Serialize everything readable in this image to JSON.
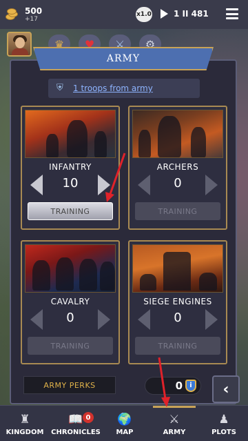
{
  "topbar": {
    "gold_amount": "500",
    "gold_delta": "+17",
    "speed": "x1.0",
    "date": "1 II 481"
  },
  "tabs": [
    {
      "icon": "crown-icon",
      "glyph": "♛"
    },
    {
      "icon": "heart-icon",
      "glyph": "♥"
    },
    {
      "icon": "sword-icon",
      "glyph": "⚔"
    },
    {
      "icon": "gear-icon",
      "glyph": "⚙"
    }
  ],
  "panel": {
    "title": "ARMY",
    "troops_text": "1 troops from army"
  },
  "units": [
    {
      "name": "INFANTRY",
      "count": "10",
      "training_label": "TRAINING",
      "training_enabled": true
    },
    {
      "name": "ARCHERS",
      "count": "0",
      "training_label": "TRAINING",
      "training_enabled": false
    },
    {
      "name": "CAVALRY",
      "count": "0",
      "training_label": "TRAINING",
      "training_enabled": false
    },
    {
      "name": "SIEGE ENGINES",
      "count": "0",
      "training_label": "TRAINING",
      "training_enabled": false
    }
  ],
  "perks": {
    "label": "ARMY PERKS",
    "count": "0"
  },
  "back_icon": "‹",
  "nav": [
    {
      "label": "KINGDOM",
      "icon": "castle-icon",
      "glyph": "♜"
    },
    {
      "label": "CHRONICLES",
      "icon": "book-icon",
      "glyph": "📖",
      "badge": "0"
    },
    {
      "label": "MAP",
      "icon": "globe-icon",
      "glyph": "🌍"
    },
    {
      "label": "ARMY",
      "icon": "crossed-swords-icon",
      "glyph": "⚔",
      "active": true
    },
    {
      "label": "PLOTS",
      "icon": "hood-icon",
      "glyph": "♟"
    }
  ],
  "colors": {
    "accent_gold": "#c8a357",
    "banner_blue": "#4d6fb0",
    "link_blue": "#8eb4ff",
    "annotation_red": "#e0222a"
  }
}
